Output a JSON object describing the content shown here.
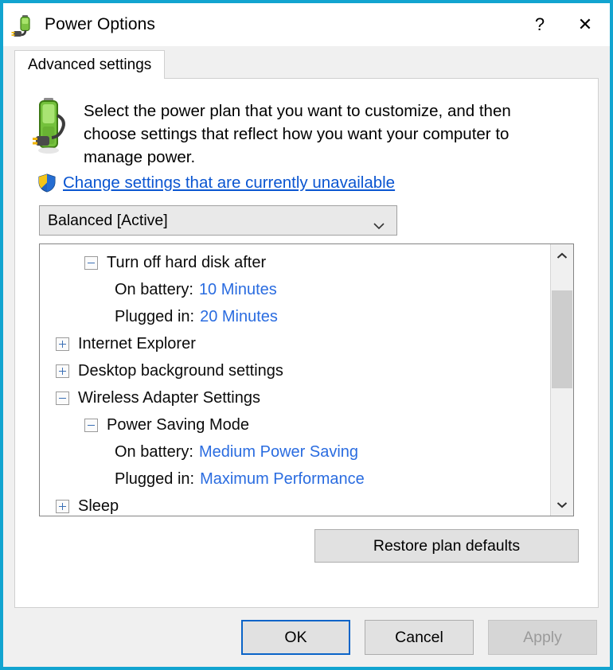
{
  "window": {
    "title": "Power Options",
    "icon": "power-plug-battery-icon",
    "accent_border": "#12a4d0",
    "help_label": "?",
    "close_label": "✕"
  },
  "tabs": [
    {
      "label": "Advanced settings",
      "selected": true
    }
  ],
  "header": {
    "icon": "battery-plug-icon",
    "description": "Select the power plan that you want to customize, and then choose settings that reflect how you want your computer to manage power.",
    "uac_link": {
      "icon": "shield-icon",
      "label": "Change settings that are currently unavailable",
      "color": "#0a55d1"
    }
  },
  "plan_select": {
    "value": "Balanced [Active]",
    "icon": "chevron-down-icon"
  },
  "settings_tree": {
    "value_color": "#2a6ce0",
    "rows": [
      {
        "indent": 1,
        "expander": "minus",
        "label": "Turn off hard disk after",
        "value": ""
      },
      {
        "indent": 2,
        "expander": "none",
        "label": "On battery:",
        "value": "10 Minutes"
      },
      {
        "indent": 2,
        "expander": "none",
        "label": "Plugged in:",
        "value": "20 Minutes"
      },
      {
        "indent": 0,
        "expander": "plus",
        "label": "Internet Explorer",
        "value": ""
      },
      {
        "indent": 0,
        "expander": "plus",
        "label": "Desktop background settings",
        "value": ""
      },
      {
        "indent": 0,
        "expander": "minus",
        "label": "Wireless Adapter Settings",
        "value": ""
      },
      {
        "indent": 1,
        "expander": "minus",
        "label": "Power Saving Mode",
        "value": ""
      },
      {
        "indent": 2,
        "expander": "none",
        "label": "On battery:",
        "value": "Medium Power Saving"
      },
      {
        "indent": 2,
        "expander": "none",
        "label": "Plugged in:",
        "value": "Maximum Performance"
      },
      {
        "indent": 0,
        "expander": "plus",
        "label": "Sleep",
        "value": ""
      }
    ],
    "scrollbar": {
      "up_icon": "chevron-up-icon",
      "down_icon": "chevron-down-icon"
    }
  },
  "buttons": {
    "restore": "Restore plan defaults",
    "ok": "OK",
    "cancel": "Cancel",
    "apply": "Apply"
  }
}
